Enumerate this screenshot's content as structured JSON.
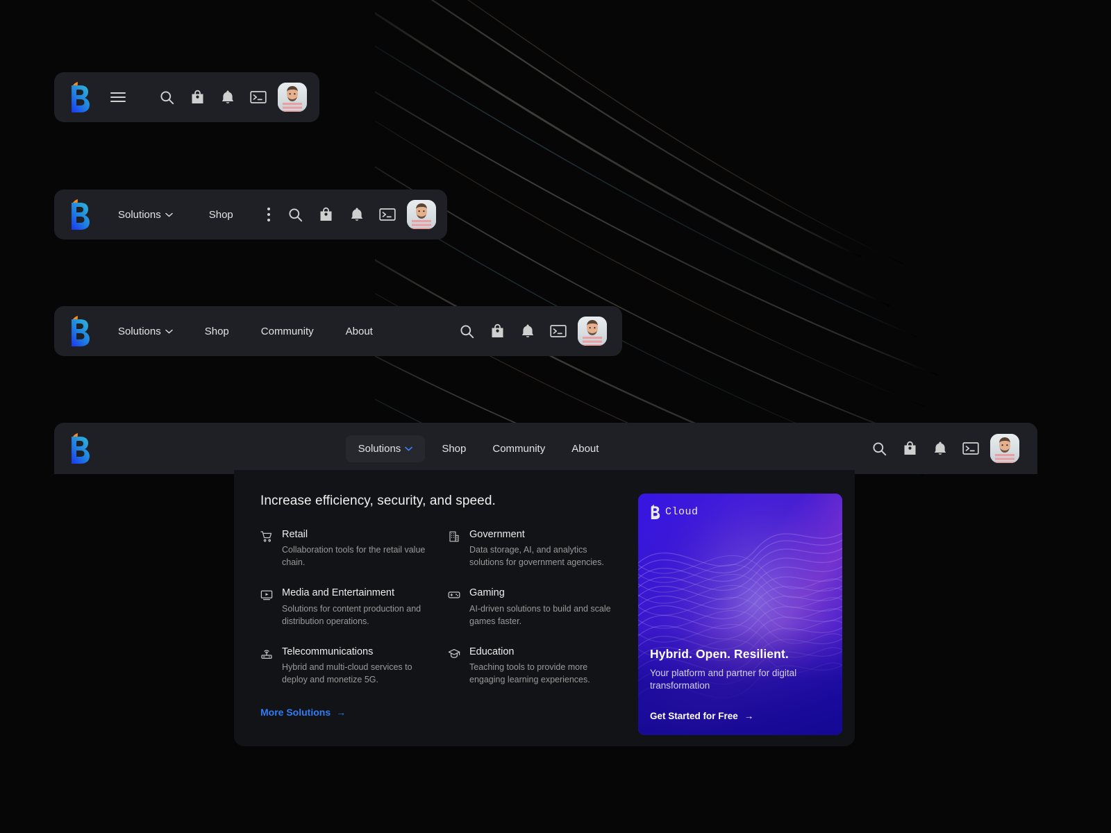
{
  "brand": {
    "logo_icon": "b-logo-icon",
    "colors": {
      "accent_blue": "#2f7df6",
      "promo_bg": "#2712d8",
      "navbar_bg": "#1e2025",
      "panel_bg": "#121316",
      "page_bg": "#060607"
    }
  },
  "navbars": [
    {
      "id": "navbar-compact",
      "menu_icon": "hamburger-icon",
      "links": [],
      "actions": [
        "search-icon",
        "shopping-bag-icon",
        "bell-icon",
        "terminal-icon"
      ],
      "avatar": "user-avatar"
    },
    {
      "id": "navbar-short",
      "links": [
        {
          "label": "Solutions",
          "has_chevron": true
        },
        {
          "label": "Shop",
          "has_chevron": false
        }
      ],
      "overflow_icon": "kebab-menu-icon",
      "actions": [
        "search-icon",
        "shopping-bag-icon",
        "bell-icon",
        "terminal-icon"
      ],
      "avatar": "user-avatar"
    },
    {
      "id": "navbar-medium",
      "links": [
        {
          "label": "Solutions",
          "has_chevron": true
        },
        {
          "label": "Shop",
          "has_chevron": false
        },
        {
          "label": "Community",
          "has_chevron": false
        },
        {
          "label": "About",
          "has_chevron": false
        }
      ],
      "actions": [
        "search-icon",
        "shopping-bag-icon",
        "bell-icon",
        "terminal-icon"
      ],
      "avatar": "user-avatar"
    },
    {
      "id": "navbar-full",
      "links": [
        {
          "label": "Solutions",
          "has_chevron": true,
          "active": true
        },
        {
          "label": "Shop",
          "has_chevron": false
        },
        {
          "label": "Community",
          "has_chevron": false
        },
        {
          "label": "About",
          "has_chevron": false
        }
      ],
      "actions": [
        "search-icon",
        "shopping-bag-icon",
        "bell-icon",
        "terminal-icon"
      ],
      "avatar": "user-avatar"
    }
  ],
  "dropdown": {
    "heading": "Increase efficiency, security, and speed.",
    "solutions": [
      {
        "icon": "shopping-cart-icon",
        "title": "Retail",
        "desc": "Collaboration tools for the retail value chain."
      },
      {
        "icon": "government-building-icon",
        "title": "Government",
        "desc": "Data storage, AI, and analytics solutions for government agencies."
      },
      {
        "icon": "video-play-icon",
        "title": "Media and Entertainment",
        "desc": "Solutions for content production and distribution operations."
      },
      {
        "icon": "gamepad-icon",
        "title": "Gaming",
        "desc": "AI-driven solutions to build and scale games faster."
      },
      {
        "icon": "router-icon",
        "title": "Telecommunications",
        "desc": "Hybrid and multi-cloud services to deploy and monetize 5G."
      },
      {
        "icon": "graduation-cap-icon",
        "title": "Education",
        "desc": "Teaching tools to provide more engaging learning experiences."
      }
    ],
    "more_link": {
      "label": "More Solutions",
      "arrow": "→"
    },
    "promo": {
      "logo_text": "Cloud",
      "title": "Hybrid. Open. Resilient.",
      "subtitle": "Your platform and partner for digital transformation",
      "cta": "Get Started for Free",
      "cta_arrow": "→"
    }
  }
}
